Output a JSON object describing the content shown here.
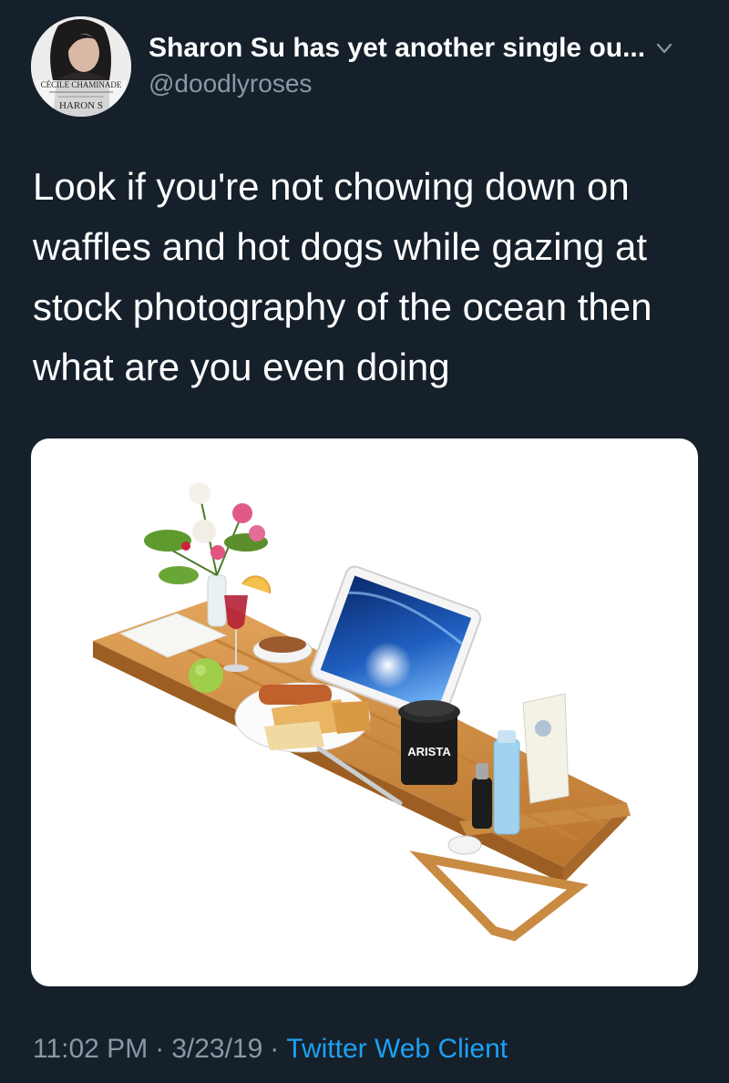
{
  "tweet": {
    "author": {
      "display_name": "Sharon Su has yet another single ou...",
      "handle": "@doodlyroses",
      "avatar_text": [
        "CÉCILE CHAMINADE",
        "HARON S"
      ]
    },
    "text_lines": [
      "Look if you're not chowing down on",
      "waffles and hot dogs while gazing at",
      "stock photography of the ocean then",
      "what are you even doing"
    ],
    "media": {
      "cup_label": "ARISTA"
    },
    "meta": {
      "time": "11:02 PM",
      "date": "3/23/19",
      "separator": "·",
      "client": "Twitter Web Client"
    }
  },
  "colors": {
    "background": "#15202b",
    "secondary_text": "#8899a6",
    "link": "#1da1f2"
  },
  "icons": [
    "chevron-down-icon"
  ]
}
